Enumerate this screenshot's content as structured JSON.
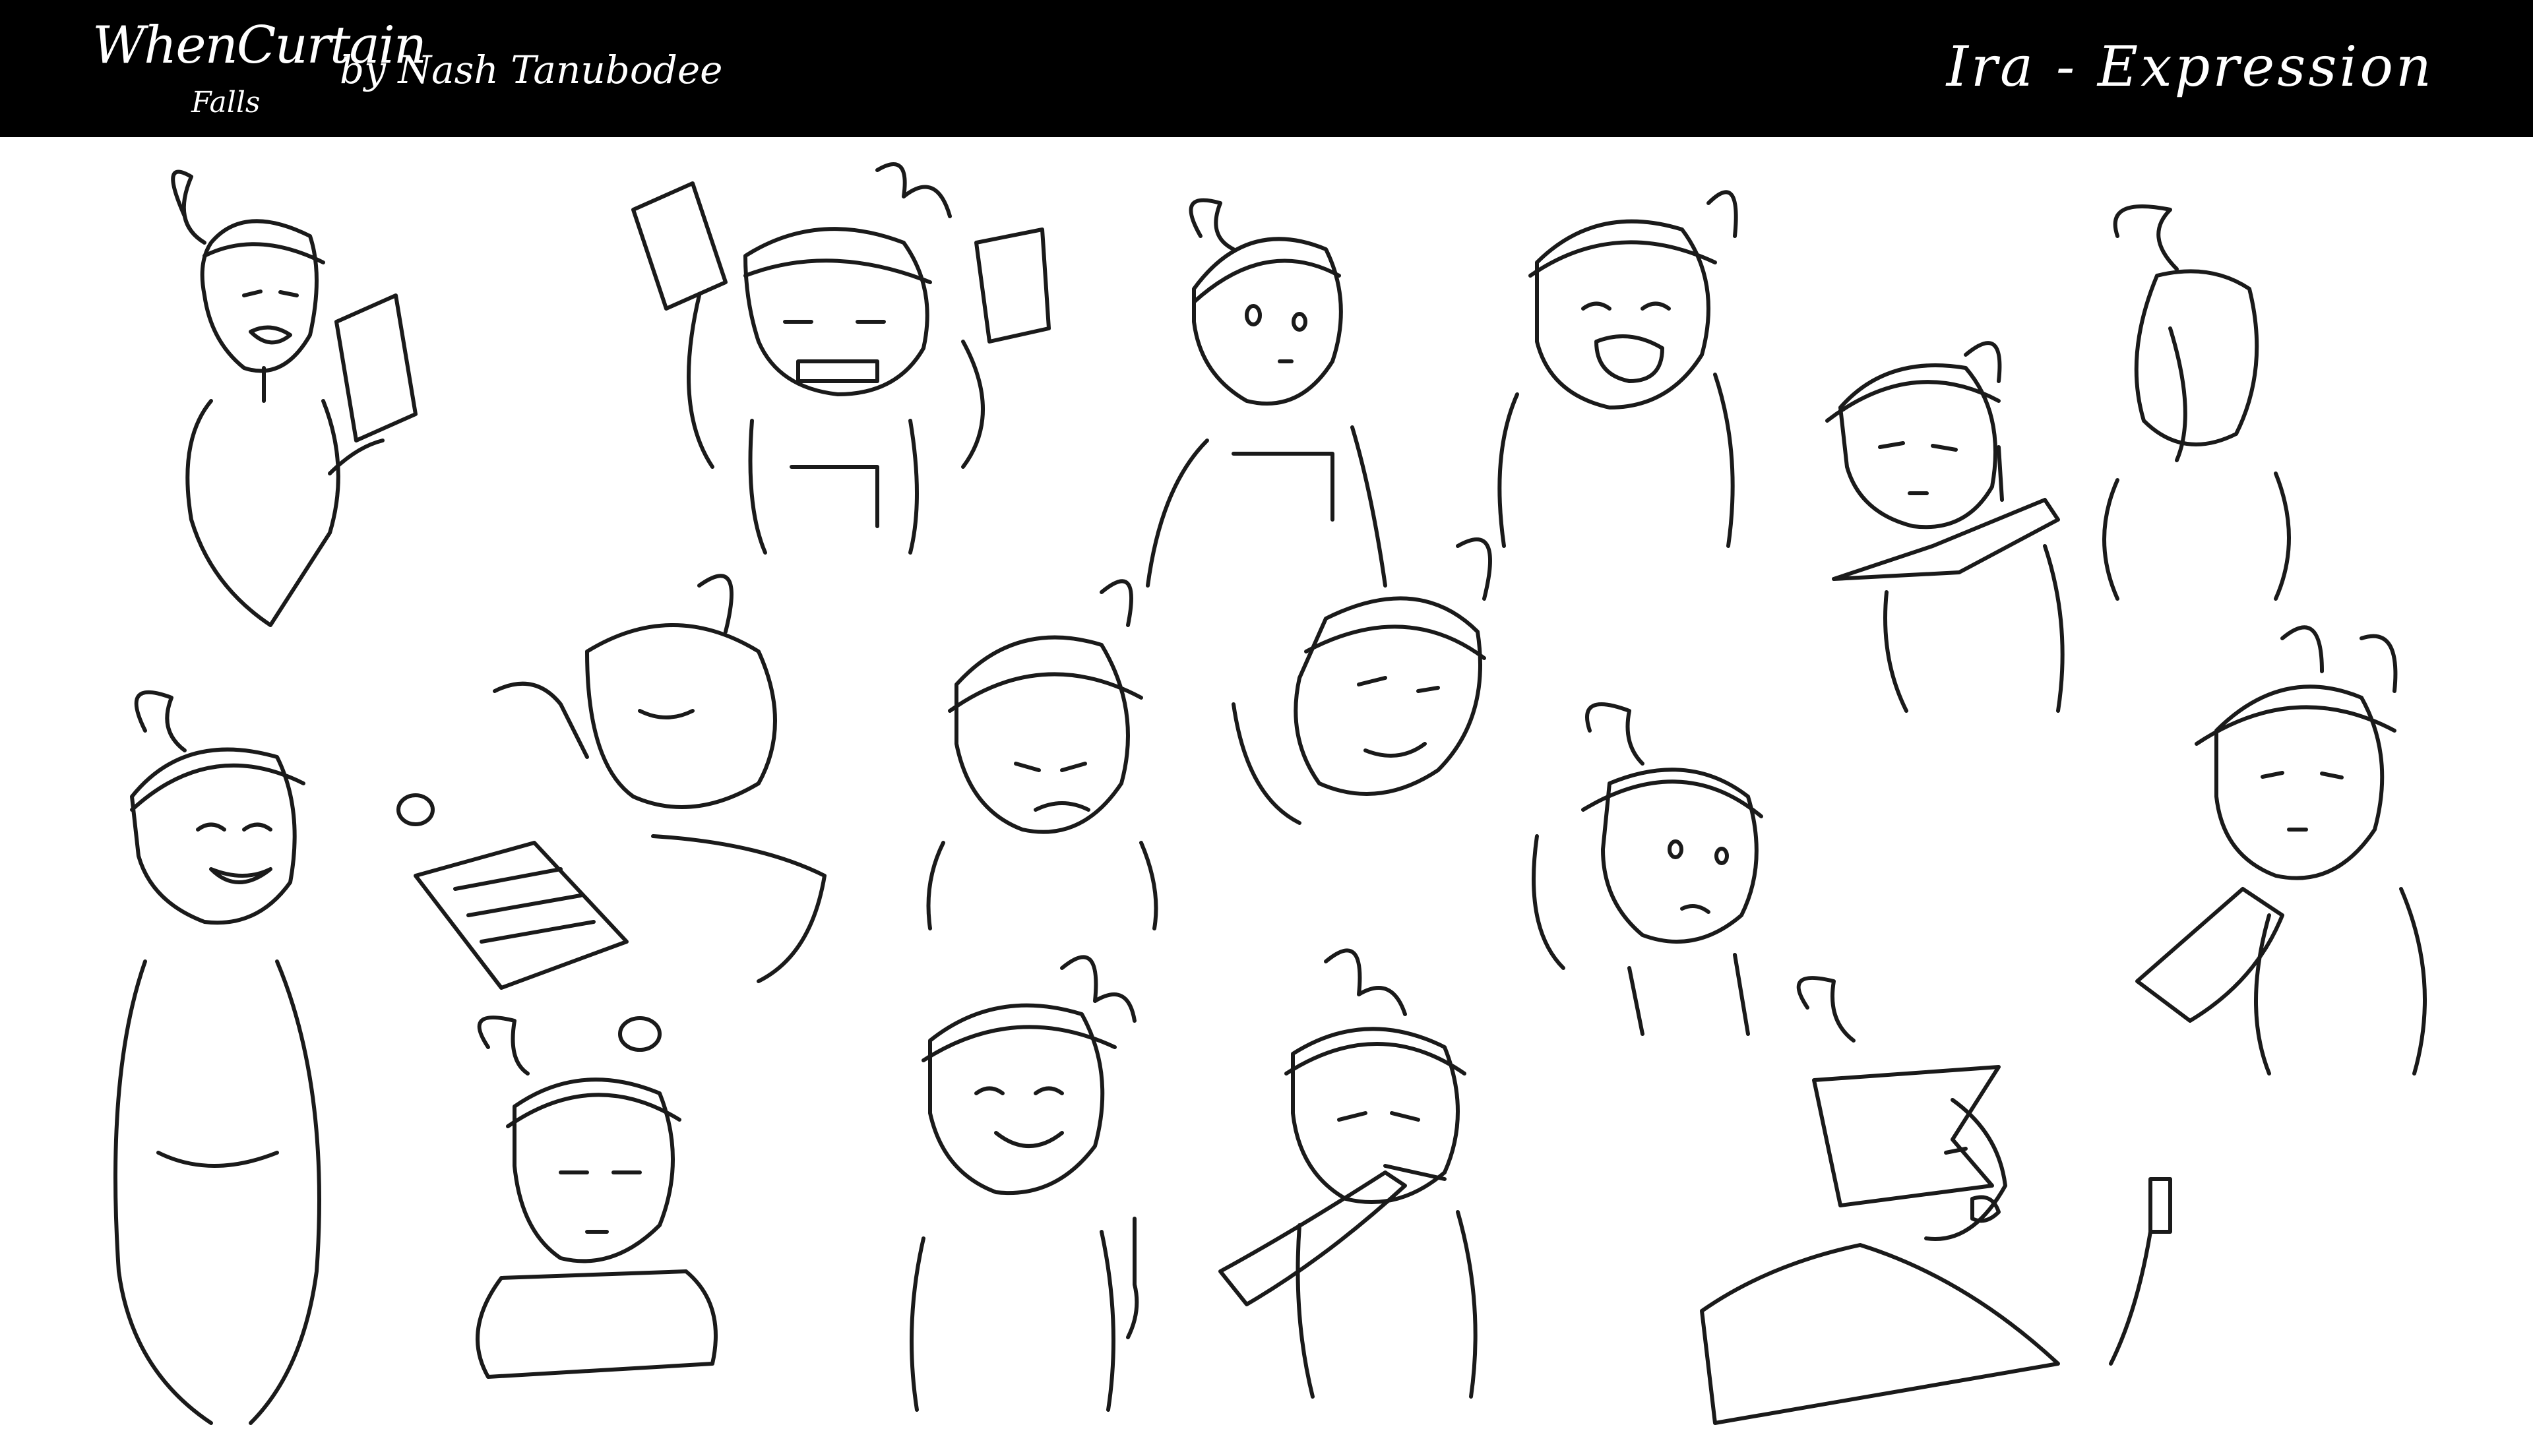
{
  "header": {
    "logo_main": "WhenCurtain",
    "logo_sub": "Falls",
    "byline": "by Nash Tanubodee",
    "title": "Ira - Expression"
  },
  "colors": {
    "header_bg": "#000000",
    "header_text": "#ffffff",
    "sheet_bg": "#ffffff",
    "line": "#1a1a1a"
  },
  "sketches": [
    {
      "name": "sketch-angry-reading-paper",
      "expression": "angry"
    },
    {
      "name": "sketch-tearing-paper",
      "expression": "frustrated"
    },
    {
      "name": "sketch-looking-up",
      "expression": "surprised"
    },
    {
      "name": "sketch-crying",
      "expression": "crying"
    },
    {
      "name": "sketch-holding-knife",
      "expression": "determined"
    },
    {
      "name": "sketch-back-view",
      "expression": "neutral"
    },
    {
      "name": "sketch-laughing-eyes-closed",
      "expression": "laughing"
    },
    {
      "name": "sketch-asleep-at-desk",
      "expression": "tired"
    },
    {
      "name": "sketch-head-down-grimace",
      "expression": "grimace"
    },
    {
      "name": "sketch-smug-tilt",
      "expression": "smug"
    },
    {
      "name": "sketch-worried-look",
      "expression": "worried"
    },
    {
      "name": "sketch-teary-pointing",
      "expression": "teary"
    },
    {
      "name": "sketch-resting-chin-bored",
      "expression": "bored"
    },
    {
      "name": "sketch-cheerful-finger-up",
      "expression": "cheerful"
    },
    {
      "name": "sketch-brushing-teeth",
      "expression": "annoyed"
    },
    {
      "name": "sketch-shouting-phone",
      "expression": "shouting"
    }
  ]
}
